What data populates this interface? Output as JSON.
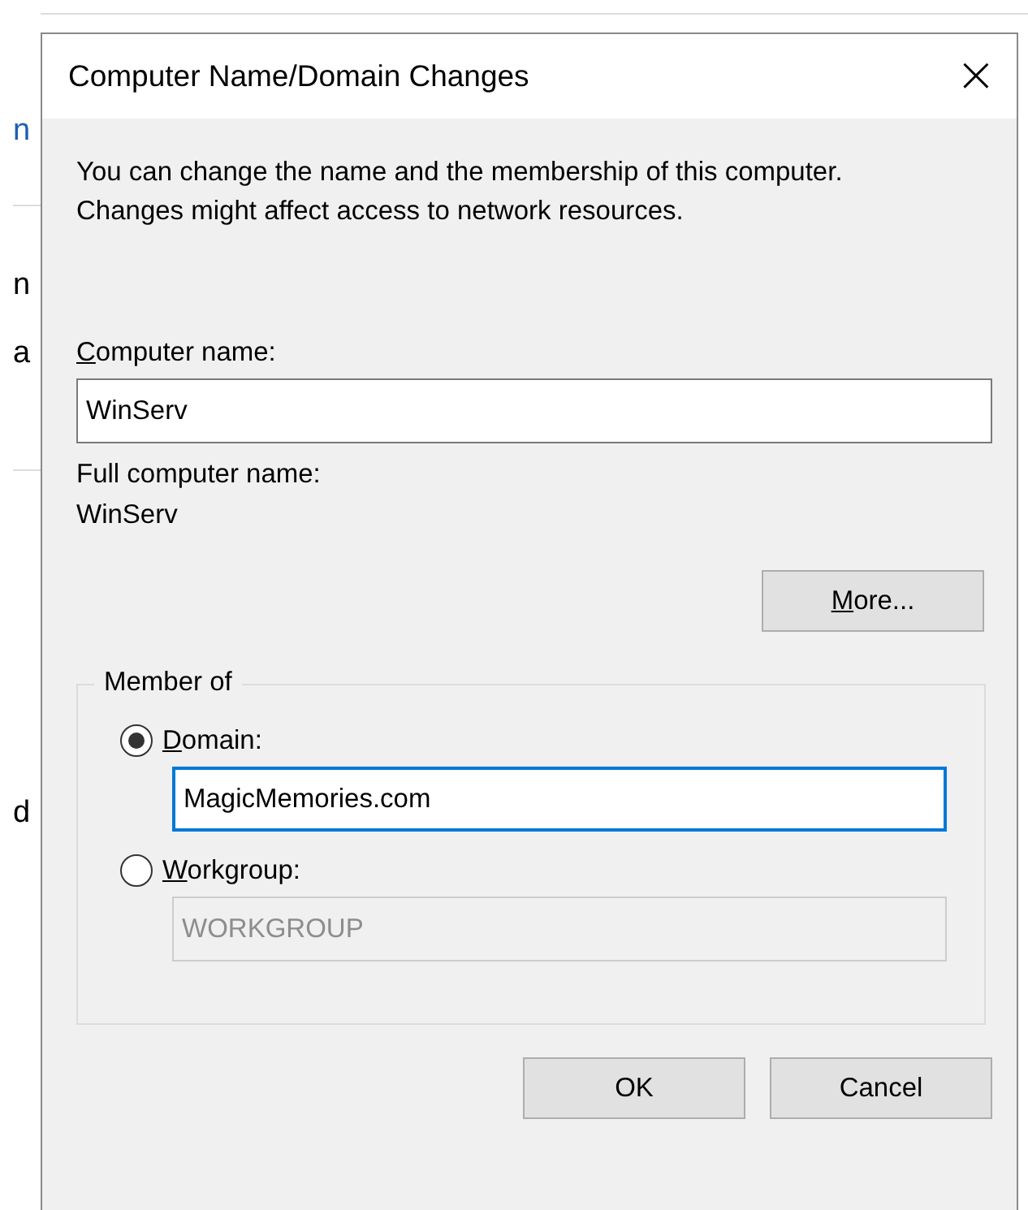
{
  "background_window": {
    "fragments": [
      {
        "text": "n",
        "kind": "link"
      },
      {
        "text": "n",
        "kind": "text"
      },
      {
        "text": "a",
        "kind": "text"
      },
      {
        "text": "d",
        "kind": "text"
      }
    ]
  },
  "dialog": {
    "title": "Computer Name/Domain Changes",
    "close": "×",
    "description": "You can change the name and the membership of this computer. Changes might affect access to network resources.",
    "computer_name": {
      "label": "Computer name:",
      "mnemonic": true,
      "value": "WinServ"
    },
    "full_name": {
      "label": "Full computer name:",
      "value": "WinServ"
    },
    "more_button": {
      "label": "More...",
      "mnemonic": true
    },
    "member_of": {
      "title": "Member of",
      "options": [
        {
          "label": "Domain:",
          "mnemonic": true,
          "selected": true,
          "value": "MagicMemories.com",
          "disabled": false,
          "focused": true
        },
        {
          "label": "Workgroup:",
          "mnemonic": true,
          "selected": false,
          "value": "WORKGROUP",
          "disabled": true,
          "focused": false
        }
      ]
    },
    "buttons": [
      {
        "label": "OK"
      },
      {
        "label": "Cancel"
      }
    ]
  }
}
